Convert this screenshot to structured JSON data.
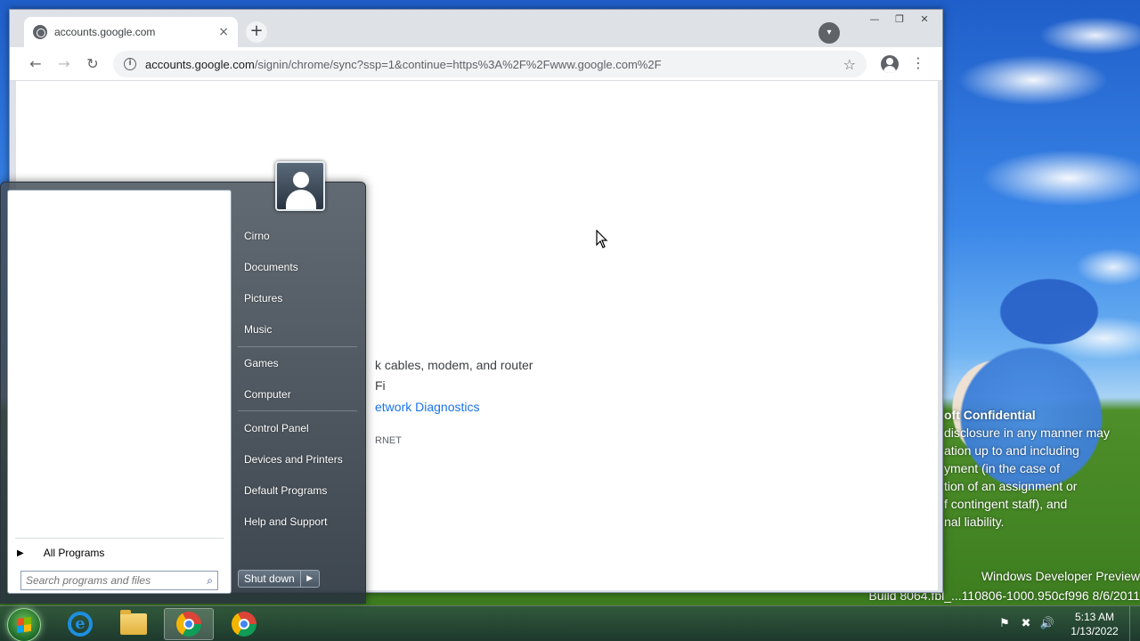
{
  "browser": {
    "tab": {
      "title": "accounts.google.com",
      "close_glyph": "×"
    },
    "new_tab_glyph": "+",
    "window_controls": [
      "—",
      "❐",
      "✕"
    ],
    "toolbar": {
      "back_glyph": "←",
      "forward_glyph": "→",
      "reload_glyph": "↻",
      "url_host": "accounts.google.com",
      "url_path": "/signin/chrome/sync?ssp=1&continue=https%3A%2F%2Fwww.google.com%2F",
      "info_glyph": "i",
      "star_glyph": "☆",
      "menu_glyph": "⋮"
    },
    "content": {
      "line1": "k cables, modem, and router",
      "line2": "Fi",
      "line3": "etwork Diagnostics",
      "line4": "RNET"
    }
  },
  "start_menu": {
    "places": [
      {
        "label": "Cirno"
      },
      {
        "label": "Documents"
      },
      {
        "label": "Pictures"
      },
      {
        "label": "Music"
      },
      {
        "label": "Games"
      },
      {
        "label": "Computer"
      },
      {
        "label": "Control Panel"
      },
      {
        "label": "Devices and Printers"
      },
      {
        "label": "Default Programs"
      },
      {
        "label": "Help and Support"
      }
    ],
    "all_programs": "All Programs",
    "all_programs_arrow": "▶",
    "search_placeholder": "Search programs and files",
    "shutdown_label": "Shut down",
    "shutdown_arrow": "▶"
  },
  "desktop": {
    "watermark": {
      "title": "oft Confidential",
      "lines": [
        "disclosure in any manner may",
        "ation up to and including",
        "yment (in the case of",
        "tion of an assignment or",
        "f contingent staff), and",
        "nal liability."
      ]
    },
    "build_line1": "Windows Developer Preview",
    "build_line2": "Build 8064.fbl_...110806-1000.950cf996 8/6/2011"
  },
  "taskbar": {
    "items": [
      "internet-explorer",
      "windows-explorer",
      "google-chrome",
      "google-chrome"
    ],
    "tray_glyphs": [
      "⚑",
      "✖",
      "🔊"
    ],
    "time": "5:13 AM",
    "date": "1/13/2022"
  },
  "colors": {
    "link_blue": "#1a73e8",
    "chrome_tab_bg": "#dee1e6"
  }
}
